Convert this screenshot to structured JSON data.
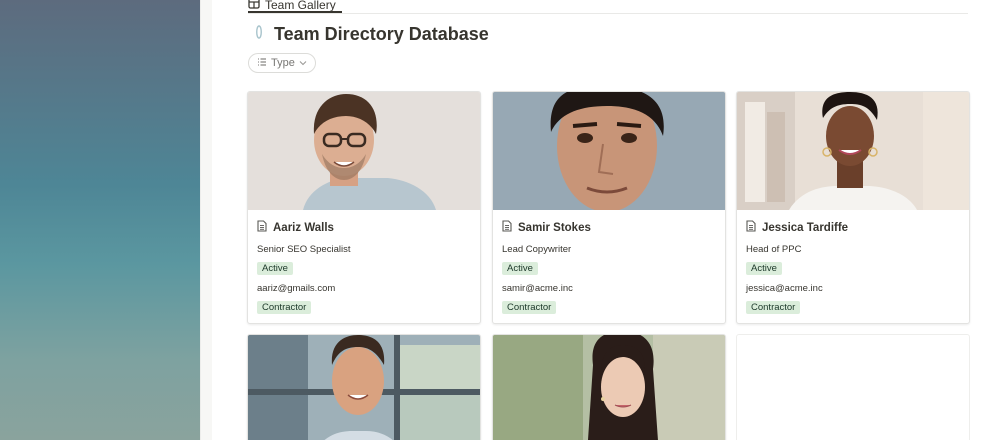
{
  "view_tab": {
    "label": "Team Gallery"
  },
  "database": {
    "title": "Team Directory Database"
  },
  "filter": {
    "label": "Type"
  },
  "cards": [
    {
      "name": "Aariz Walls",
      "role": "Senior SEO Specialist",
      "status": "Active",
      "email": "aariz@gmails.com",
      "type": "Contractor"
    },
    {
      "name": "Samir Stokes",
      "role": "Lead Copywriter",
      "status": "Active",
      "email": "samir@acme.inc",
      "type": "Contractor"
    },
    {
      "name": "Jessica Tardiffe",
      "role": "Head of PPC",
      "status": "Active",
      "email": "jessica@acme.inc",
      "type": "Contractor"
    }
  ],
  "colors": {
    "tag_bg": "#dbeddb",
    "tag_text": "#1c3829",
    "accent_text": "#37352f"
  }
}
